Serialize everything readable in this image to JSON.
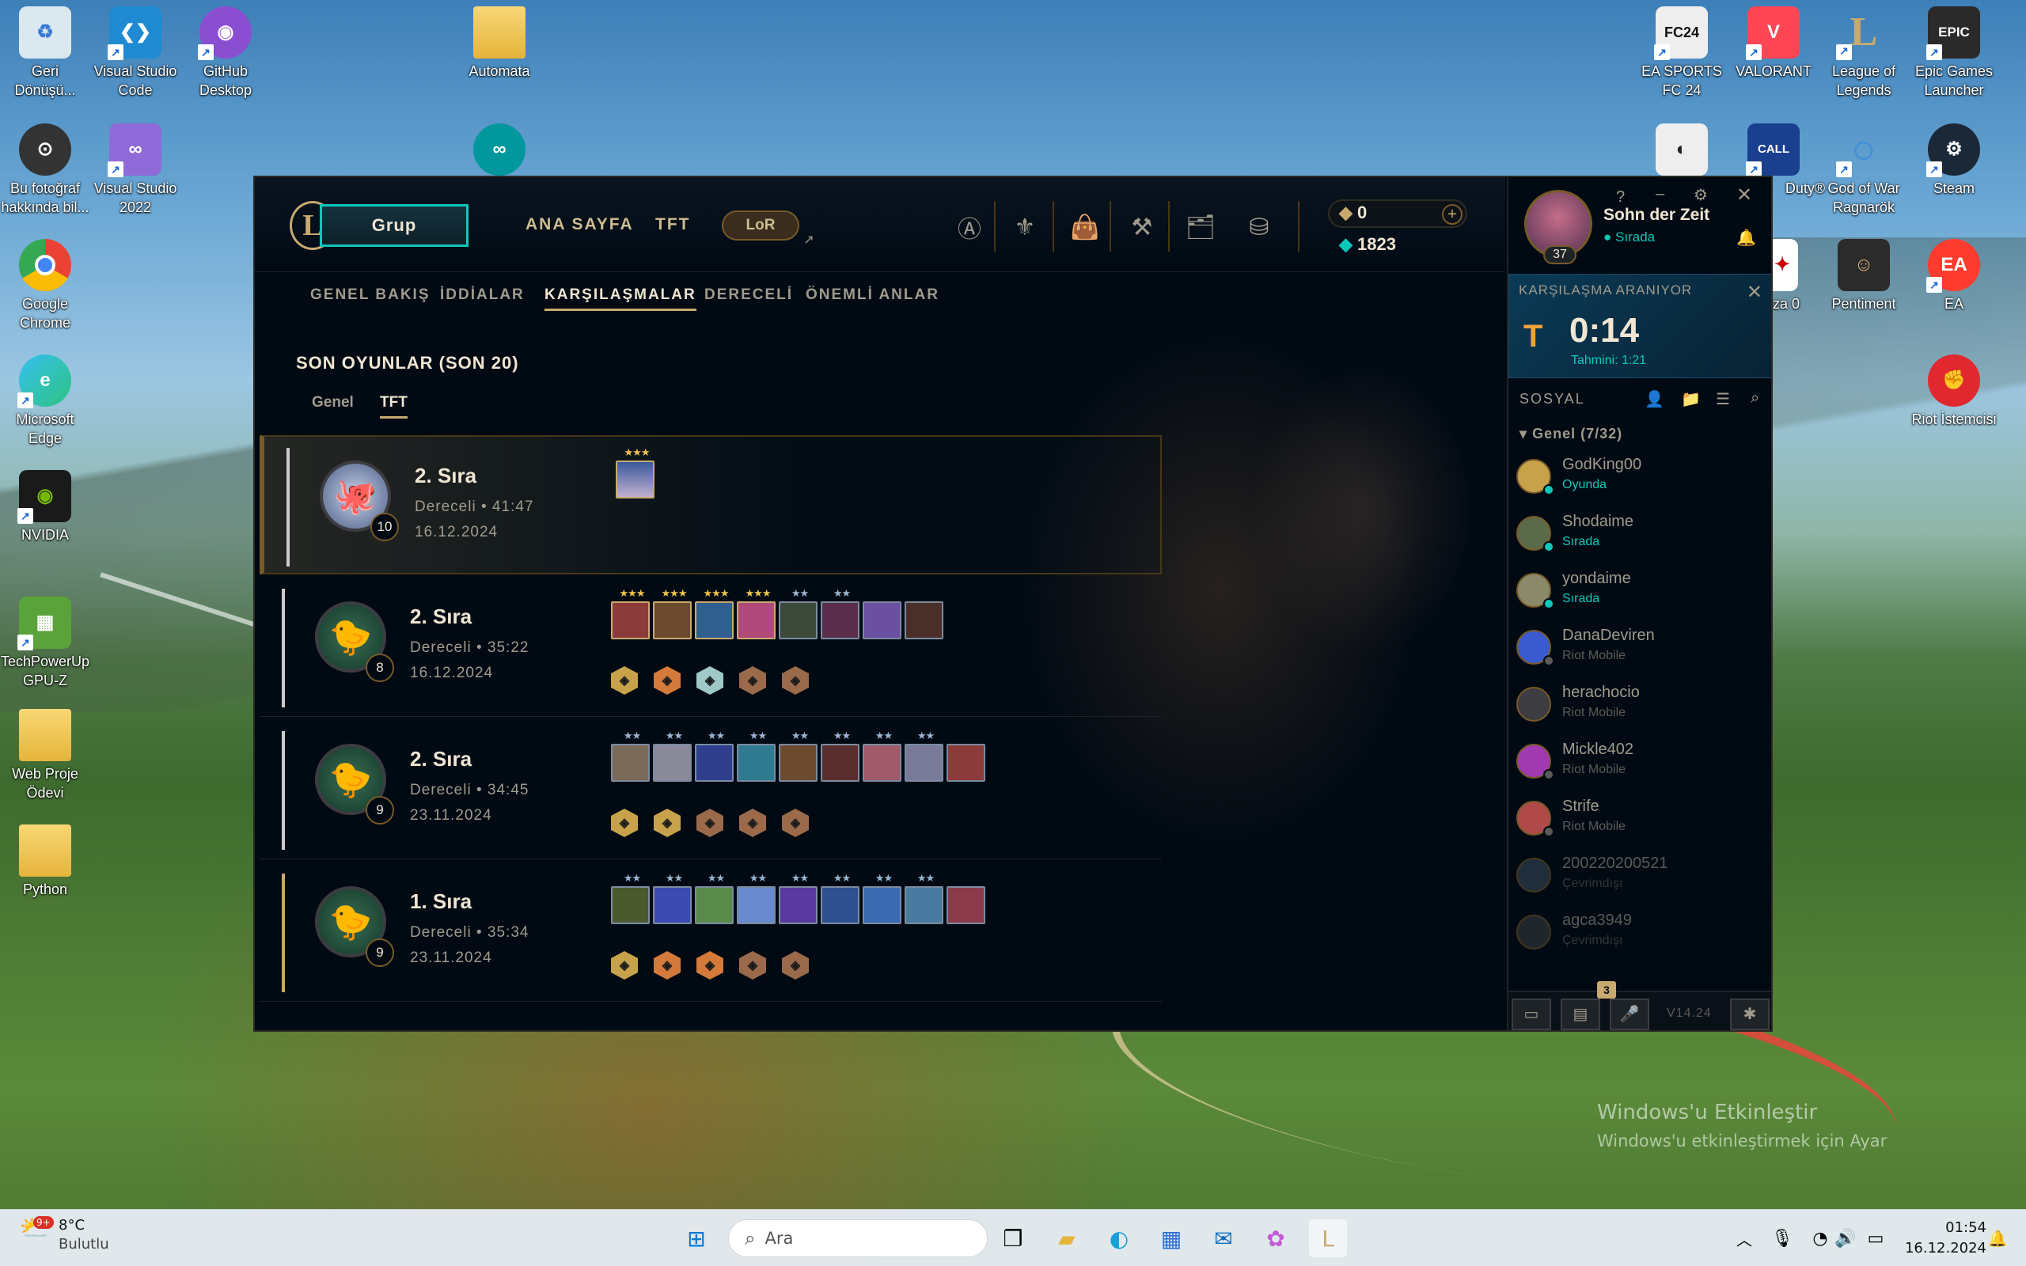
{
  "desktop": {
    "left_icons": [
      {
        "label": "Geri Dönüşü...",
        "icon": "recycle-bin-icon"
      },
      {
        "label": "Visual Studio Code",
        "icon": "vscode-icon"
      },
      {
        "label": "GitHub Desktop",
        "icon": "github-icon"
      },
      {
        "label": "Automata",
        "icon": "folder-icon"
      },
      {
        "label": "Bu fotoğraf hakkında bil...",
        "icon": "camera-icon"
      },
      {
        "label": "Visual Studio 2022",
        "icon": "visual-studio-icon"
      },
      {
        "label": "Google Chrome",
        "icon": "chrome-icon"
      },
      {
        "label": "Microsoft Edge",
        "icon": "edge-icon"
      },
      {
        "label": "NVIDIA",
        "icon": "nvidia-icon"
      },
      {
        "label": "TechPowerUp GPU-Z",
        "icon": "gpuz-icon"
      },
      {
        "label": "Web Proje Ödevi",
        "icon": "folder-icon"
      },
      {
        "label": "Python",
        "icon": "folder-icon"
      }
    ],
    "right_icons": [
      {
        "label": "EA SPORTS FC 24",
        "icon": "fc24-icon"
      },
      {
        "label": "VALORANT",
        "icon": "valorant-icon"
      },
      {
        "label": "League of Legends",
        "icon": "lol-icon"
      },
      {
        "label": "Epic Games Launcher",
        "icon": "epic-icon"
      },
      {
        "label": "Duty®",
        "icon": "cod-icon"
      },
      {
        "label": "God of War Ragnarök",
        "icon": "gow-icon"
      },
      {
        "label": "Steam",
        "icon": "steam-icon"
      },
      {
        "label": "uza 0",
        "icon": "app-icon"
      },
      {
        "label": "Pentiment",
        "icon": "pentiment-icon"
      },
      {
        "label": "EA",
        "icon": "ea-icon"
      },
      {
        "label": "Riot İstemcisi",
        "icon": "riot-icon"
      }
    ],
    "watermark": {
      "line1": "Windows'u Etkinleştir",
      "line2": "Windows'u etkinleştirmek için Ayar"
    }
  },
  "client": {
    "play_button": "Grup",
    "nav": [
      "ANA SAYFA",
      "TFT"
    ],
    "lor": "LoR",
    "rp": "0",
    "be": "1823",
    "subnav": [
      "GENEL BAKIŞ",
      "İDDİALAR",
      "KARŞILAŞMALAR",
      "DERECELİ",
      "ÖNEMLİ ANLAR"
    ],
    "section_title": "SON OYUNLAR (SON 20)",
    "tabs": [
      "Genel",
      "TFT"
    ],
    "matches": [
      {
        "place": "2. Sıra",
        "info": "Dereceli • 41:47",
        "date": "16.12.2024",
        "level": "10"
      },
      {
        "place": "2. Sıra",
        "info": "Dereceli • 35:22",
        "date": "16.12.2024",
        "level": "8"
      },
      {
        "place": "2. Sıra",
        "info": "Dereceli • 34:45",
        "date": "23.11.2024",
        "level": "9"
      },
      {
        "place": "1. Sıra",
        "info": "Dereceli • 35:34",
        "date": "23.11.2024",
        "level": "9"
      }
    ]
  },
  "social": {
    "name": "Sohn der Zeit",
    "status": "Sırada",
    "level": "37",
    "queue_title": "KARŞILAŞMA ARANIYOR",
    "queue_time": "0:14",
    "queue_est": "Tahmini: 1:21",
    "title": "SOSYAL",
    "group": "Genel (7/32)",
    "friends": [
      {
        "name": "GodKing00",
        "status": "Oyunda",
        "color": "#0ac8b9"
      },
      {
        "name": "Shodaime",
        "status": "Sırada",
        "color": "#0ac8b9"
      },
      {
        "name": "yondaime",
        "status": "Sırada",
        "color": "#0ac8b9"
      },
      {
        "name": "DanaDeviren",
        "status": "Riot Mobile",
        "color": "#5b5a56"
      },
      {
        "name": "herachocio",
        "status": "Riot Mobile",
        "color": "#5b5a56"
      },
      {
        "name": "Mickle402",
        "status": "Riot Mobile",
        "color": "#5b5a56"
      },
      {
        "name": "Strife",
        "status": "Riot Mobile",
        "color": "#5b5a56"
      },
      {
        "name": "200220200521",
        "status": "Çevrimdışı",
        "color": "#5b5a56"
      },
      {
        "name": "agca3949",
        "status": "Çevrimdışı",
        "color": "#5b5a56"
      }
    ],
    "badge": "3",
    "version": "V14.24"
  },
  "taskbar": {
    "weather_badge": "9+",
    "temp": "8°C",
    "condition": "Bulutlu",
    "search_placeholder": "Ara",
    "time": "01:54",
    "date": "16.12.2024"
  },
  "colors": {
    "gold": "#c8aa6e",
    "teal": "#0ac8b9",
    "bg": "#010a13"
  }
}
